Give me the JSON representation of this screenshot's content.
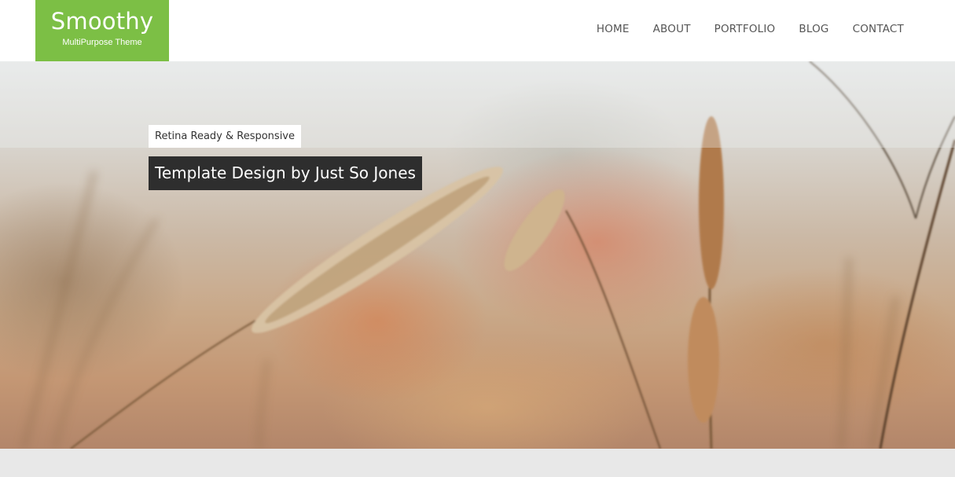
{
  "header": {
    "logo": {
      "title": "Smoothy",
      "subtitle": "MultiPurpose Theme",
      "color": "#7cbf45"
    },
    "nav": [
      {
        "label": "HOME"
      },
      {
        "label": "ABOUT"
      },
      {
        "label": "PORTFOLIO"
      },
      {
        "label": "BLOG"
      },
      {
        "label": "CONTACT"
      }
    ]
  },
  "hero": {
    "tagline": "Retina Ready & Responsive",
    "headline": "Template Design by Just So Jones"
  }
}
